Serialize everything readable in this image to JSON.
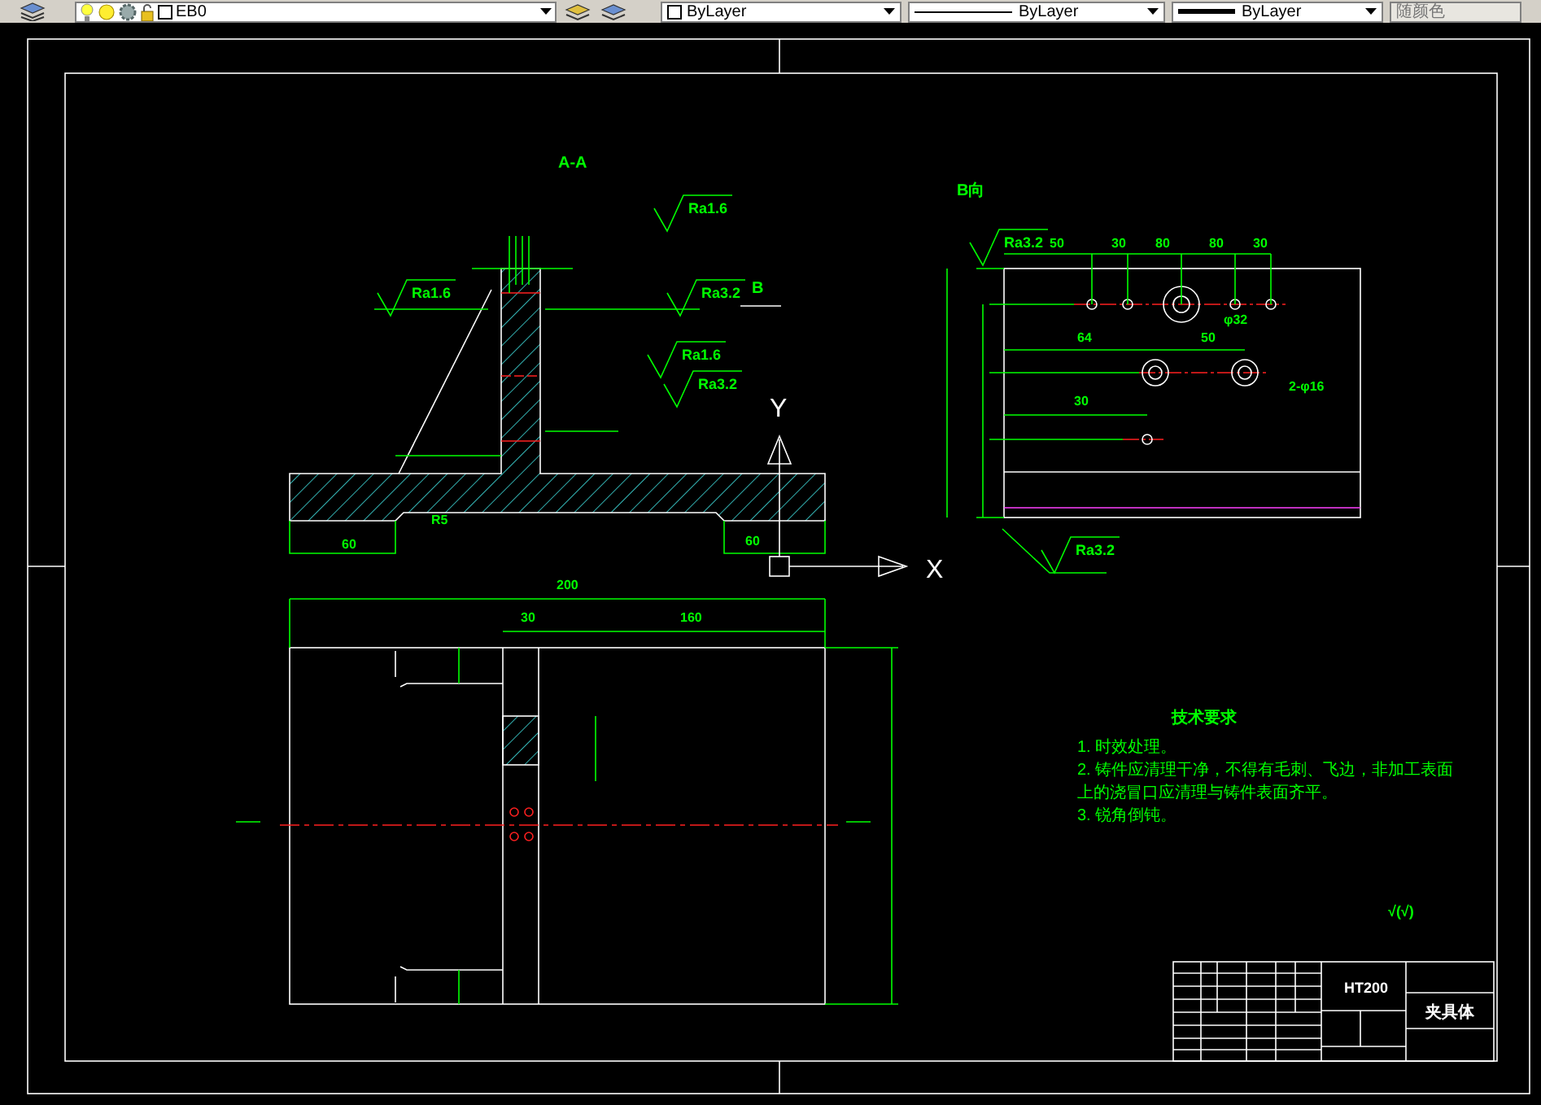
{
  "toolbar": {
    "layer": "EB0",
    "color_control": "ByLayer",
    "linetype": "ByLayer",
    "lineweight": "ByLayer",
    "plot_style": "随颜色"
  },
  "annotations": [
    {
      "kind": "title",
      "text": "A-A"
    },
    {
      "kind": "title",
      "text": "B向"
    },
    {
      "kind": "roughness",
      "text": "Ra1.6"
    },
    {
      "kind": "roughness",
      "text": "Ra1.6"
    },
    {
      "kind": "roughness",
      "text": "Ra3.2"
    },
    {
      "kind": "roughness",
      "text": "Ra1.6"
    },
    {
      "kind": "roughness",
      "text": "Ra3.2"
    },
    {
      "kind": "title",
      "text": "B"
    },
    {
      "kind": "dimension",
      "text": "60"
    },
    {
      "kind": "dimension",
      "text": "R5"
    },
    {
      "kind": "dimension",
      "text": "60"
    },
    {
      "kind": "roughness",
      "text": "Ra3.2"
    },
    {
      "kind": "dimension",
      "text": "50"
    },
    {
      "kind": "dimension",
      "text": "30"
    },
    {
      "kind": "dimension",
      "text": "80"
    },
    {
      "kind": "dimension",
      "text": "80"
    },
    {
      "kind": "dimension",
      "text": "30"
    },
    {
      "kind": "dimension",
      "text": "φ32"
    },
    {
      "kind": "dimension",
      "text": "64"
    },
    {
      "kind": "dimension",
      "text": "50"
    },
    {
      "kind": "dimension",
      "text": "2-φ16"
    },
    {
      "kind": "dimension",
      "text": "30"
    },
    {
      "kind": "roughness",
      "text": "Ra3.2"
    },
    {
      "kind": "dimension",
      "text": "200"
    },
    {
      "kind": "dimension",
      "text": "30"
    },
    {
      "kind": "dimension",
      "text": "160"
    },
    {
      "kind": "roughness",
      "text": "√(√)"
    }
  ],
  "axes": {
    "x": "X",
    "y": "Y"
  },
  "requirements": {
    "title": "技术要求",
    "lines": [
      "1. 时效处理。",
      "2. 铸件应清理干净，不得有毛刺、飞边，非加工表面",
      "上的浇冒口应清理与铸件表面齐平。",
      "3. 锐角倒钝。"
    ]
  },
  "title_block": {
    "material": "HT200",
    "part_name": "夹具体"
  }
}
